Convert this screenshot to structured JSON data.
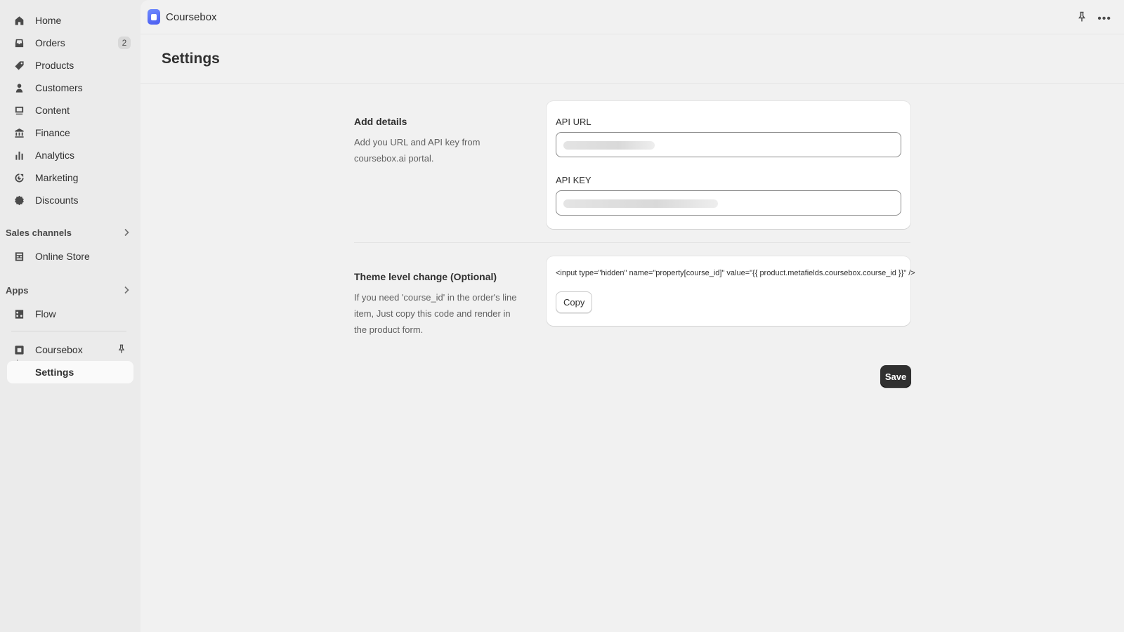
{
  "sidebar": {
    "items": [
      {
        "label": "Home",
        "icon": "home-icon"
      },
      {
        "label": "Orders",
        "icon": "orders-icon",
        "badge": "2"
      },
      {
        "label": "Products",
        "icon": "tag-icon"
      },
      {
        "label": "Customers",
        "icon": "person-icon"
      },
      {
        "label": "Content",
        "icon": "content-icon"
      },
      {
        "label": "Finance",
        "icon": "bank-icon"
      },
      {
        "label": "Analytics",
        "icon": "bar-chart-icon"
      },
      {
        "label": "Marketing",
        "icon": "target-icon"
      },
      {
        "label": "Discounts",
        "icon": "discount-icon"
      }
    ],
    "sales_channels": {
      "label": "Sales channels",
      "items": [
        {
          "label": "Online Store",
          "icon": "store-icon"
        }
      ]
    },
    "apps": {
      "label": "Apps",
      "items": [
        {
          "label": "Flow",
          "icon": "flow-icon"
        }
      ]
    },
    "pinned_app": {
      "label": "Coursebox",
      "icon": "coursebox-icon",
      "sub_item": "Settings"
    }
  },
  "topbar": {
    "app_name": "Coursebox"
  },
  "page": {
    "title": "Settings",
    "details_section": {
      "title": "Add details",
      "description": "Add you URL and API key from coursebox.ai portal.",
      "api_url_label": "API URL",
      "api_key_label": "API KEY"
    },
    "theme_section": {
      "title": "Theme level change (Optional)",
      "description": "If you need 'course_id' in the order's line item, Just copy this code and render in the product form.",
      "code": "<input type=\"hidden\" name=\"property[course_id]\" value=\"{{ product.metafields.coursebox.course_id }}\" />",
      "copy_label": "Copy"
    },
    "save_label": "Save"
  },
  "colors": {
    "accent_button": "#303030",
    "sidebar_bg": "#ebebeb",
    "main_bg": "#f1f1f1"
  }
}
